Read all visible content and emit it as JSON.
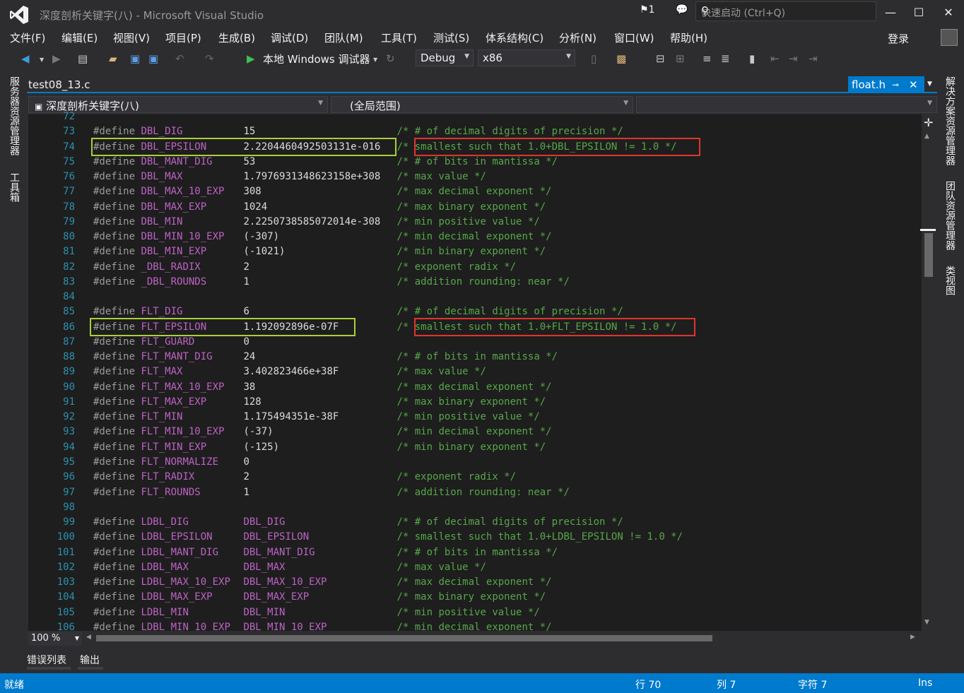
{
  "window": {
    "title": "深度剖析关键字(八) - Microsoft Visual Studio",
    "notifications": "1",
    "quick_launch_placeholder": "快速启动 (Ctrl+Q)",
    "login": "登录"
  },
  "menu": [
    "文件(F)",
    "编辑(E)",
    "视图(V)",
    "项目(P)",
    "生成(B)",
    "调试(D)",
    "团队(M)",
    "工具(T)",
    "测试(S)",
    "体系结构(C)",
    "分析(N)",
    "窗口(W)",
    "帮助(H)"
  ],
  "toolbar": {
    "debugger_label": "本地 Windows 调试器",
    "configuration": "Debug",
    "platform": "x86"
  },
  "left_tabs": [
    "服务器资源管理器",
    "工具箱"
  ],
  "right_tabs": [
    "解决方案资源管理器",
    "团队资源管理器",
    "类视图"
  ],
  "document": {
    "file_tab": "test08_13.c",
    "active_tab": "float.h",
    "project_scope": "深度剖析关键字(八)",
    "scope": "(全局范围)",
    "zoom": "100 %"
  },
  "code": {
    "lines": [
      {
        "n": "72",
        "name": "",
        "value": "",
        "comment": ""
      },
      {
        "n": "73",
        "name": "DBL_DIG",
        "value": "15",
        "comment": "/* # of decimal digits of precision */"
      },
      {
        "n": "74",
        "name": "DBL_EPSILON",
        "value": "2.2204460492503131e-016",
        "comment": "/* smallest such that 1.0+DBL_EPSILON != 1.0 */"
      },
      {
        "n": "75",
        "name": "DBL_MANT_DIG",
        "value": "53",
        "comment": "/* # of bits in mantissa */"
      },
      {
        "n": "76",
        "name": "DBL_MAX",
        "value": "1.7976931348623158e+308",
        "comment": "/* max value */"
      },
      {
        "n": "77",
        "name": "DBL_MAX_10_EXP",
        "value": "308",
        "comment": "/* max decimal exponent */"
      },
      {
        "n": "78",
        "name": "DBL_MAX_EXP",
        "value": "1024",
        "comment": "/* max binary exponent */"
      },
      {
        "n": "79",
        "name": "DBL_MIN",
        "value": "2.2250738585072014e-308",
        "comment": "/* min positive value */"
      },
      {
        "n": "80",
        "name": "DBL_MIN_10_EXP",
        "value": "(-307)",
        "comment": "/* min decimal exponent */"
      },
      {
        "n": "81",
        "name": "DBL_MIN_EXP",
        "value": "(-1021)",
        "comment": "/* min binary exponent */"
      },
      {
        "n": "82",
        "name": "_DBL_RADIX",
        "value": "2",
        "comment": "/* exponent radix */"
      },
      {
        "n": "83",
        "name": "_DBL_ROUNDS",
        "value": "1",
        "comment": "/* addition rounding: near */"
      },
      {
        "n": "84",
        "name": "",
        "value": "",
        "comment": ""
      },
      {
        "n": "85",
        "name": "FLT_DIG",
        "value": "6",
        "comment": "/* # of decimal digits of precision */"
      },
      {
        "n": "86",
        "name": "FLT_EPSILON",
        "value": "1.192092896e-07F",
        "comment": "/* smallest such that 1.0+FLT_EPSILON != 1.0 */"
      },
      {
        "n": "87",
        "name": "FLT_GUARD",
        "value": "0",
        "comment": ""
      },
      {
        "n": "88",
        "name": "FLT_MANT_DIG",
        "value": "24",
        "comment": "/* # of bits in mantissa */"
      },
      {
        "n": "89",
        "name": "FLT_MAX",
        "value": "3.402823466e+38F",
        "comment": "/* max value */"
      },
      {
        "n": "90",
        "name": "FLT_MAX_10_EXP",
        "value": "38",
        "comment": "/* max decimal exponent */"
      },
      {
        "n": "91",
        "name": "FLT_MAX_EXP",
        "value": "128",
        "comment": "/* max binary exponent */"
      },
      {
        "n": "92",
        "name": "FLT_MIN",
        "value": "1.175494351e-38F",
        "comment": "/* min positive value */"
      },
      {
        "n": "93",
        "name": "FLT_MIN_10_EXP",
        "value": "(-37)",
        "comment": "/* min decimal exponent */"
      },
      {
        "n": "94",
        "name": "FLT_MIN_EXP",
        "value": "(-125)",
        "comment": "/* min binary exponent */"
      },
      {
        "n": "95",
        "name": "FLT_NORMALIZE",
        "value": "0",
        "comment": ""
      },
      {
        "n": "96",
        "name": "FLT_RADIX",
        "value": "2",
        "comment": "/* exponent radix */"
      },
      {
        "n": "97",
        "name": "FLT_ROUNDS",
        "value": "1",
        "comment": "/* addition rounding: near */"
      },
      {
        "n": "98",
        "name": "",
        "value": "",
        "comment": ""
      },
      {
        "n": "99",
        "name": "LDBL_DIG",
        "value": "DBL_DIG",
        "comment": "/* # of decimal digits of precision */"
      },
      {
        "n": "100",
        "name": "LDBL_EPSILON",
        "value": "DBL_EPSILON",
        "comment": "/* smallest such that 1.0+LDBL_EPSILON != 1.0 */"
      },
      {
        "n": "101",
        "name": "LDBL_MANT_DIG",
        "value": "DBL_MANT_DIG",
        "comment": "/* # of bits in mantissa */"
      },
      {
        "n": "102",
        "name": "LDBL_MAX",
        "value": "DBL_MAX",
        "comment": "/* max value */"
      },
      {
        "n": "103",
        "name": "LDBL_MAX_10_EXP",
        "value": "DBL_MAX_10_EXP",
        "comment": "/* max decimal exponent */"
      },
      {
        "n": "104",
        "name": "LDBL_MAX_EXP",
        "value": "DBL_MAX_EXP",
        "comment": "/* max binary exponent */"
      },
      {
        "n": "105",
        "name": "LDBL_MIN",
        "value": "DBL_MIN",
        "comment": "/* min positive value */"
      },
      {
        "n": "106",
        "name": "LDBL_MIN_10_EXP",
        "value": "DBL_MIN_10_EXP",
        "comment": "/* min decimal exponent */"
      }
    ],
    "define_keyword": "#define"
  },
  "bottom_tabs": [
    "错误列表",
    "输出"
  ],
  "status": {
    "ready": "就绪",
    "line": "行 70",
    "col": "列 7",
    "char": "字符 7",
    "mode": "Ins"
  },
  "colors": {
    "accent": "#007acc",
    "highlight_green": "#a9d03a",
    "highlight_red": "#e0352b"
  }
}
